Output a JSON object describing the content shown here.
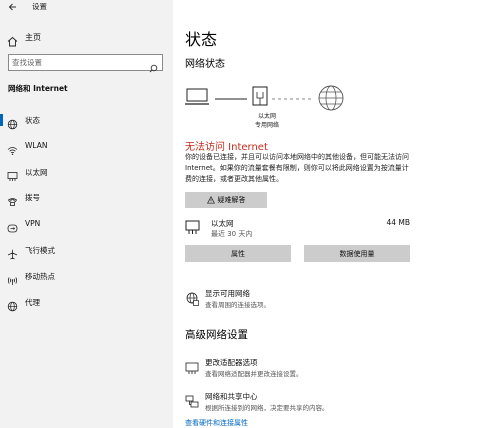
{
  "window": {
    "title": "设置"
  },
  "sidebar": {
    "home_label": "主页",
    "search_placeholder": "查找设置",
    "section_title": "网络和 Internet",
    "items": [
      {
        "label": "状态",
        "icon": "globe-icon",
        "active": true
      },
      {
        "label": "WLAN",
        "icon": "wifi-icon"
      },
      {
        "label": "以太网",
        "icon": "ethernet-icon"
      },
      {
        "label": "拨号",
        "icon": "dialup-icon"
      },
      {
        "label": "VPN",
        "icon": "vpn-icon"
      },
      {
        "label": "飞行模式",
        "icon": "airplane-icon"
      },
      {
        "label": "移动热点",
        "icon": "hotspot-icon"
      },
      {
        "label": "代理",
        "icon": "proxy-globe-icon"
      }
    ]
  },
  "main": {
    "page_title": "状态",
    "network_status_title": "网络状态",
    "connection_label_1": "以太网",
    "connection_label_2": "专用网络",
    "error_title": "无法访问 Internet",
    "error_desc": "你的设备已连接，并且可以访问本地网络中的其他设备，但可能无法访问 Internet。如果你的流量套餐有限制，则你可以将此网络设置为按流量计费的连接，或者更改其他属性。",
    "troubleshoot_label": "疑难解答",
    "ethernet": {
      "name": "以太网",
      "sub": "最近 30 天内",
      "size": "44 MB"
    },
    "properties_label": "属性",
    "data_usage_label": "数据使用量",
    "show_networks": {
      "title": "显示可用网络",
      "sub": "查看周围的连接选项。"
    },
    "advanced_title": "高级网络设置",
    "adapter_options": {
      "title": "更改适配器选项",
      "sub": "查看网络适配器并更改连接设置。"
    },
    "sharing_center": {
      "title": "网络和共享中心",
      "sub": "根据所连接到的网络，决定要共享的内容。"
    },
    "bottom_link": "查看硬件和连接属性"
  },
  "colors": {
    "accent": "#0067c0",
    "error": "#c42b1c",
    "sidebar_bg": "#f2f2f2",
    "button_bg": "#cccccc"
  }
}
